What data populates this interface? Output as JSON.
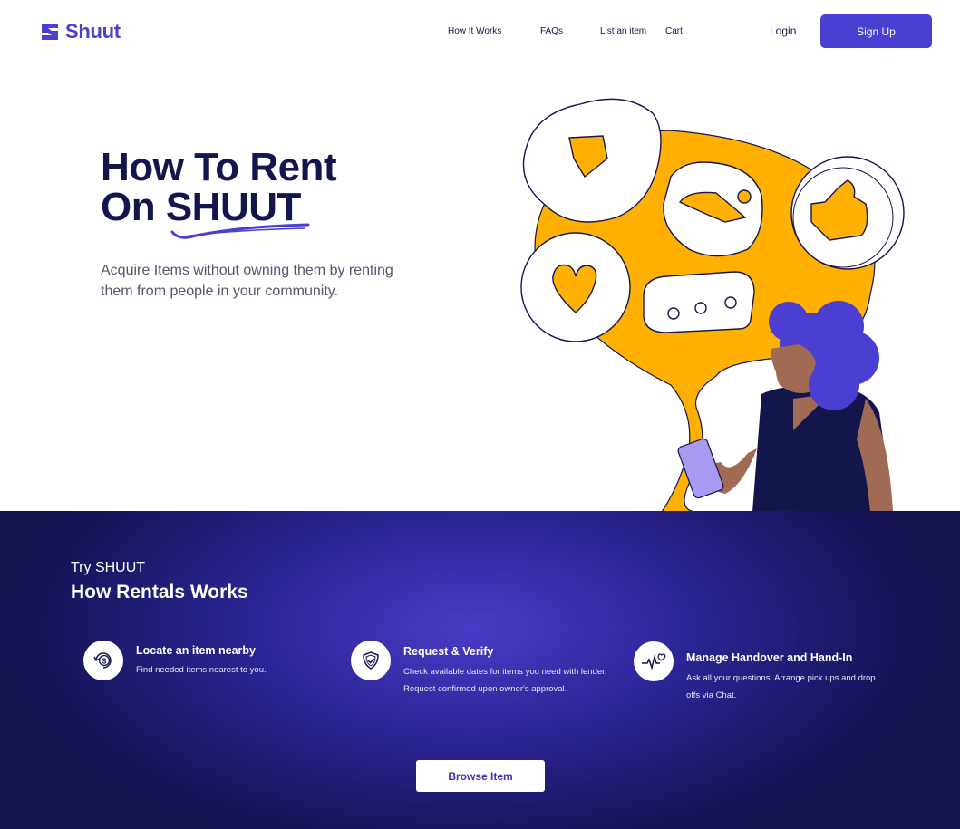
{
  "brand": {
    "name": "Shuut",
    "accent": "#4a3fd0",
    "navy": "#13154d",
    "yellow": "#ffb000"
  },
  "nav": {
    "links": [
      "How It Works",
      "FAQs",
      "List an item",
      "Cart"
    ],
    "login": "Login",
    "signup": "Sign Up"
  },
  "hero": {
    "title_line1": "How To Rent",
    "title_line2": "On SHUUT",
    "subtitle": "Acquire Items without owning them by renting them from people in your community."
  },
  "how": {
    "eyebrow": "Try SHUUT",
    "title": "How Rentals Works",
    "steps": [
      {
        "icon": "dollar-cycle-icon",
        "title": "Locate an item nearby",
        "desc": "Find needed items nearest to you."
      },
      {
        "icon": "shield-check-icon",
        "title": "Request & Verify",
        "desc": "Check available dates for items you need with lender.  Request confirmed upon owner's approval."
      },
      {
        "icon": "heartbeat-icon",
        "title": "Manage Handover and Hand-In",
        "desc": "Ask all your questions, Arrange pick ups and drop offs via Chat."
      }
    ],
    "cta": "Browse Item"
  }
}
